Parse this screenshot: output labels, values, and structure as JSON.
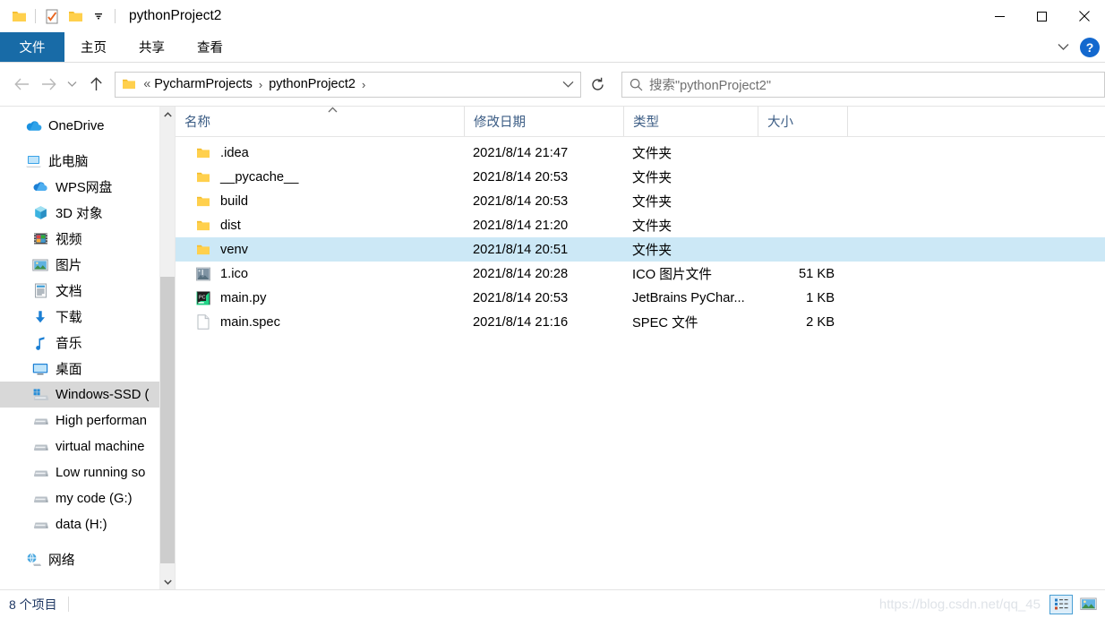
{
  "window": {
    "title": "pythonProject2",
    "quick_access": [
      {
        "name": "folder-icon",
        "label": "文件夹"
      },
      {
        "name": "properties-icon",
        "label": "属性"
      },
      {
        "name": "new-folder-icon",
        "label": "新建文件夹"
      },
      {
        "name": "customize-dropdown-icon",
        "label": "自定义快速访问工具栏"
      }
    ],
    "controls": {
      "minimize": "最小化",
      "maximize": "最大化",
      "close": "关闭"
    }
  },
  "ribbon": {
    "tabs": [
      {
        "label": "文件",
        "active": true
      },
      {
        "label": "主页",
        "active": false
      },
      {
        "label": "共享",
        "active": false
      },
      {
        "label": "查看",
        "active": false
      }
    ],
    "expand_label": "展开功能区",
    "help_label": "?"
  },
  "navbar": {
    "back": "后退",
    "forward": "前进",
    "recent": "最近浏览的位置",
    "up": "上移到",
    "breadcrumb": {
      "overflow": "«",
      "items": [
        "PycharmProjects",
        "pythonProject2"
      ],
      "separator": "›"
    },
    "dropdown_label": "以前的位置",
    "refresh_label": "刷新",
    "search": {
      "placeholder": "搜索\"pythonProject2\"",
      "icon": "search-icon"
    }
  },
  "sidebar": {
    "items": [
      {
        "label": "OneDrive",
        "icon": "onedrive-cloud-icon",
        "level": 0,
        "selected": false,
        "gap_before": false
      },
      {
        "label": "此电脑",
        "icon": "this-pc-icon",
        "level": 0,
        "selected": false,
        "gap_before": true
      },
      {
        "label": "WPS网盘",
        "icon": "wps-cloud-icon",
        "level": 1,
        "selected": false,
        "gap_before": false
      },
      {
        "label": "3D 对象",
        "icon": "3d-objects-icon",
        "level": 1,
        "selected": false,
        "gap_before": false
      },
      {
        "label": "视频",
        "icon": "videos-icon",
        "level": 1,
        "selected": false,
        "gap_before": false
      },
      {
        "label": "图片",
        "icon": "pictures-icon",
        "level": 1,
        "selected": false,
        "gap_before": false
      },
      {
        "label": "文档",
        "icon": "documents-icon",
        "level": 1,
        "selected": false,
        "gap_before": false
      },
      {
        "label": "下载",
        "icon": "downloads-icon",
        "level": 1,
        "selected": false,
        "gap_before": false
      },
      {
        "label": "音乐",
        "icon": "music-icon",
        "level": 1,
        "selected": false,
        "gap_before": false
      },
      {
        "label": "桌面",
        "icon": "desktop-icon",
        "level": 1,
        "selected": false,
        "gap_before": false
      },
      {
        "label": "Windows-SSD (",
        "icon": "windows-drive-icon",
        "level": 1,
        "selected": true,
        "gap_before": false
      },
      {
        "label": "High performan",
        "icon": "drive-icon",
        "level": 1,
        "selected": false,
        "gap_before": false
      },
      {
        "label": "virtual machine",
        "icon": "drive-icon",
        "level": 1,
        "selected": false,
        "gap_before": false
      },
      {
        "label": "Low running so",
        "icon": "drive-icon",
        "level": 1,
        "selected": false,
        "gap_before": false
      },
      {
        "label": "my code (G:)",
        "icon": "drive-icon",
        "level": 1,
        "selected": false,
        "gap_before": false
      },
      {
        "label": "data (H:)",
        "icon": "drive-icon",
        "level": 1,
        "selected": false,
        "gap_before": false
      },
      {
        "label": "网络",
        "icon": "network-icon",
        "level": 0,
        "selected": false,
        "gap_before": true
      }
    ],
    "scrollbar": {
      "up": "▲",
      "down": "▼"
    }
  },
  "filelist": {
    "columns": [
      {
        "label": "名称",
        "key": "name",
        "sorted": true,
        "sort_dir": "asc"
      },
      {
        "label": "修改日期",
        "key": "date"
      },
      {
        "label": "类型",
        "key": "type"
      },
      {
        "label": "大小",
        "key": "size"
      }
    ],
    "rows": [
      {
        "name": ".idea",
        "date": "2021/8/14 21:47",
        "type": "文件夹",
        "size": "",
        "icon": "folder-icon",
        "selected": false
      },
      {
        "name": "__pycache__",
        "date": "2021/8/14 20:53",
        "type": "文件夹",
        "size": "",
        "icon": "folder-icon",
        "selected": false
      },
      {
        "name": "build",
        "date": "2021/8/14 20:53",
        "type": "文件夹",
        "size": "",
        "icon": "folder-icon",
        "selected": false
      },
      {
        "name": "dist",
        "date": "2021/8/14 21:20",
        "type": "文件夹",
        "size": "",
        "icon": "folder-icon",
        "selected": false
      },
      {
        "name": "venv",
        "date": "2021/8/14 20:51",
        "type": "文件夹",
        "size": "",
        "icon": "folder-icon",
        "selected": true
      },
      {
        "name": "1.ico",
        "date": "2021/8/14 20:28",
        "type": "ICO 图片文件",
        "size": "51 KB",
        "icon": "ico-image-icon",
        "selected": false
      },
      {
        "name": "main.py",
        "date": "2021/8/14 20:53",
        "type": "JetBrains PyChar...",
        "size": "1 KB",
        "icon": "pycharm-icon",
        "selected": false
      },
      {
        "name": "main.spec",
        "date": "2021/8/14 21:16",
        "type": "SPEC 文件",
        "size": "2 KB",
        "icon": "blank-file-icon",
        "selected": false
      }
    ]
  },
  "statusbar": {
    "item_count": "8 个项目",
    "watermark": "https://blog.csdn.net/qq_45",
    "views": [
      {
        "name": "details-view-button",
        "label": "详细信息",
        "active": true
      },
      {
        "name": "large-icons-view-button",
        "label": "大图标",
        "active": false
      }
    ]
  },
  "colors": {
    "accent_tab": "#186ba7",
    "selection": "#cce8f6",
    "sidebar_selection": "#d8d8d8",
    "header_text": "#3c5d85",
    "help_blue": "#1368ce"
  }
}
